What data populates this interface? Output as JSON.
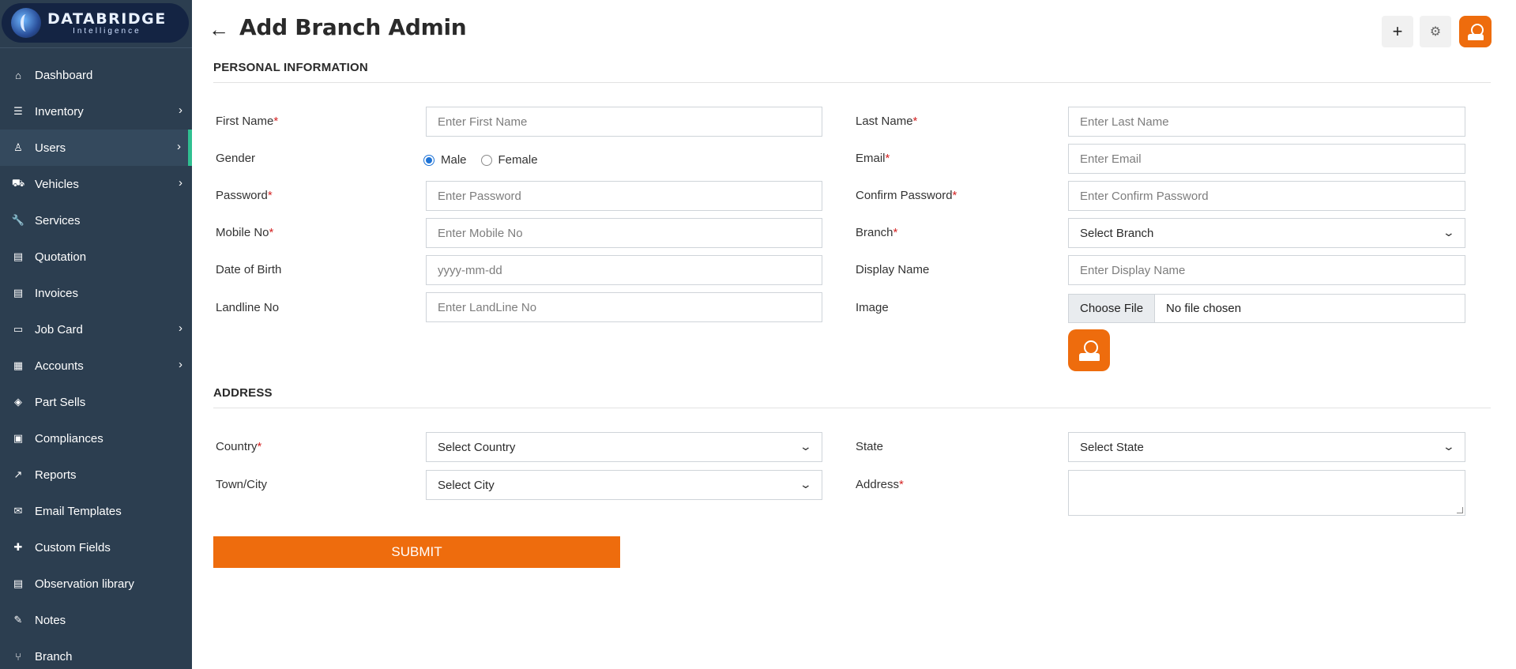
{
  "brand": {
    "name": "DATABRIDGE",
    "sub": "Intelligence"
  },
  "sidebar": {
    "items": [
      {
        "label": "Dashboard",
        "icon": "home-icon",
        "glyph": "⌂",
        "chevron": false
      },
      {
        "label": "Inventory",
        "icon": "sliders-icon",
        "glyph": "☰",
        "chevron": true
      },
      {
        "label": "Users",
        "icon": "user-icon",
        "glyph": "♙",
        "chevron": true,
        "active": true
      },
      {
        "label": "Vehicles",
        "icon": "car-icon",
        "glyph": "⛟",
        "chevron": true
      },
      {
        "label": "Services",
        "icon": "wrench-icon",
        "glyph": "🔧",
        "chevron": false
      },
      {
        "label": "Quotation",
        "icon": "file-invoice-icon",
        "glyph": "▤",
        "chevron": false
      },
      {
        "label": "Invoices",
        "icon": "receipt-icon",
        "glyph": "▤",
        "chevron": false
      },
      {
        "label": "Job Card",
        "icon": "card-icon",
        "glyph": "▭",
        "chevron": true
      },
      {
        "label": "Accounts",
        "icon": "calculator-icon",
        "glyph": "▦",
        "chevron": true
      },
      {
        "label": "Part Sells",
        "icon": "tag-icon",
        "glyph": "◈",
        "chevron": false
      },
      {
        "label": "Compliances",
        "icon": "clipboard-check-icon",
        "glyph": "▣",
        "chevron": false
      },
      {
        "label": "Reports",
        "icon": "chart-line-icon",
        "glyph": "↗",
        "chevron": false
      },
      {
        "label": "Email Templates",
        "icon": "envelope-icon",
        "glyph": "✉",
        "chevron": false
      },
      {
        "label": "Custom Fields",
        "icon": "puzzle-icon",
        "glyph": "✚",
        "chevron": false
      },
      {
        "label": "Observation library",
        "icon": "file-icon",
        "glyph": "▤",
        "chevron": false
      },
      {
        "label": "Notes",
        "icon": "edit-icon",
        "glyph": "✎",
        "chevron": false
      },
      {
        "label": "Branch",
        "icon": "branch-icon",
        "glyph": "⑂",
        "chevron": false
      }
    ]
  },
  "header": {
    "title": "Add Branch Admin",
    "add_glyph": "+",
    "settings_glyph": "⚙"
  },
  "personal": {
    "section_title": "PERSONAL INFORMATION",
    "first_name": {
      "label": "First Name",
      "placeholder": "Enter First Name"
    },
    "last_name": {
      "label": "Last Name",
      "placeholder": "Enter Last Name"
    },
    "gender": {
      "label": "Gender",
      "options": [
        "Male",
        "Female"
      ],
      "selected": "Male"
    },
    "email": {
      "label": "Email",
      "placeholder": "Enter Email"
    },
    "password": {
      "label": "Password",
      "placeholder": "Enter Password"
    },
    "confirm_password": {
      "label": "Confirm Password",
      "placeholder": "Enter Confirm Password"
    },
    "mobile": {
      "label": "Mobile No",
      "placeholder": "Enter Mobile No"
    },
    "branch": {
      "label": "Branch",
      "value": "Select Branch"
    },
    "dob": {
      "label": "Date of Birth",
      "placeholder": "yyyy-mm-dd"
    },
    "display_name": {
      "label": "Display Name",
      "placeholder": "Enter Display Name"
    },
    "landline": {
      "label": "Landline No",
      "placeholder": "Enter LandLine No"
    },
    "image": {
      "label": "Image",
      "button": "Choose File",
      "status": "No file chosen"
    }
  },
  "address": {
    "section_title": "ADDRESS",
    "country": {
      "label": "Country",
      "value": "Select Country"
    },
    "state": {
      "label": "State",
      "value": "Select State"
    },
    "city": {
      "label": "Town/City",
      "value": "Select City"
    },
    "address": {
      "label": "Address"
    }
  },
  "required_mark": "*",
  "submit_label": "SUBMIT",
  "colors": {
    "sidebar_bg": "#2c3e50",
    "accent": "#ee6c0d",
    "active_marker": "#2fbf91",
    "required": "#d42424"
  }
}
